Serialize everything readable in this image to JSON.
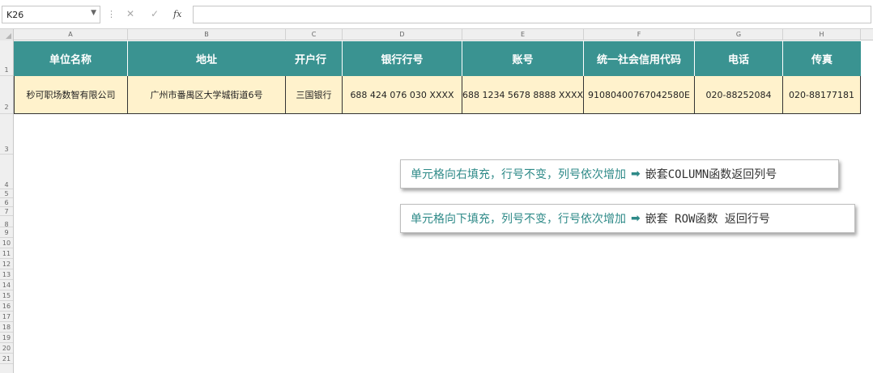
{
  "formula_bar": {
    "name_box": "K26",
    "cancel_glyph": "✕",
    "enter_glyph": "✓",
    "fx_label": "fx",
    "formula": ""
  },
  "columns": [
    "A",
    "B",
    "C",
    "D",
    "E",
    "F",
    "G",
    "H"
  ],
  "rows": [
    "1",
    "2",
    "3",
    "4",
    "5",
    "6",
    "7",
    "8",
    "9",
    "10",
    "11",
    "12",
    "13",
    "14",
    "15",
    "16",
    "17",
    "18",
    "19",
    "20",
    "21"
  ],
  "table": {
    "headers": [
      "单位名称",
      "地址",
      "开户行",
      "银行行号",
      "账号",
      "统一社会信用代码",
      "电话",
      "传真"
    ],
    "record": [
      "秒可职场数智有限公司",
      "广州市番禺区大学城街道6号",
      "三国银行",
      "688 424 076 030 XXXX",
      "688 1234 5678 8888 XXXX",
      "91080400767042580E",
      "020-88252084",
      "020-88177181"
    ]
  },
  "callouts": [
    {
      "left": "单元格向右填充，行号不变，列号依次增加",
      "arrow": "➡",
      "right": "嵌套COLUMN函数返回列号"
    },
    {
      "left": "单元格向下填充，列号不变，行号依次增加",
      "arrow": "➡",
      "right": "嵌套 ROW函数 返回行号"
    }
  ],
  "colors": {
    "header_bg": "#3a9391",
    "data_bg": "#fff2cc",
    "accent_text": "#2e8a88"
  }
}
